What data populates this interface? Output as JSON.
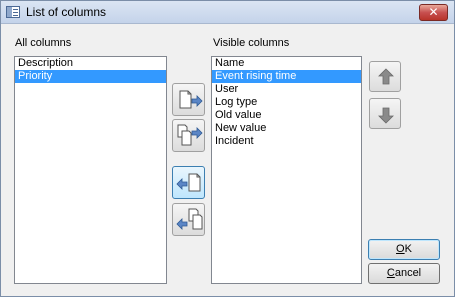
{
  "window": {
    "title": "List of columns",
    "close_glyph": "✕"
  },
  "all_columns": {
    "label": "All columns",
    "items": [
      {
        "label": "Description",
        "selected": false
      },
      {
        "label": "Priority",
        "selected": true
      }
    ]
  },
  "visible_columns": {
    "label": "Visible columns",
    "items": [
      {
        "label": "Name",
        "selected": false
      },
      {
        "label": "Event rising time",
        "selected": true
      },
      {
        "label": "User",
        "selected": false
      },
      {
        "label": "Log type",
        "selected": false
      },
      {
        "label": "Old value",
        "selected": false
      },
      {
        "label": "New value",
        "selected": false
      },
      {
        "label": "Incident",
        "selected": false
      }
    ]
  },
  "transfer_buttons": {
    "add_icon": "page-arrow-right-icon",
    "add_all_icon": "pages-arrow-right-icon",
    "remove_icon": "arrow-left-page-icon",
    "remove_all_icon": "arrow-left-pages-icon"
  },
  "order_buttons": {
    "up_icon": "arrow-up-icon",
    "down_icon": "arrow-down-icon"
  },
  "actions": {
    "ok_mnemonic": "O",
    "ok_rest": "K",
    "cancel_mnemonic": "C",
    "cancel_rest": "ancel"
  },
  "colors": {
    "selection": "#3399ff",
    "arrow_blue": "#5b86c6"
  }
}
